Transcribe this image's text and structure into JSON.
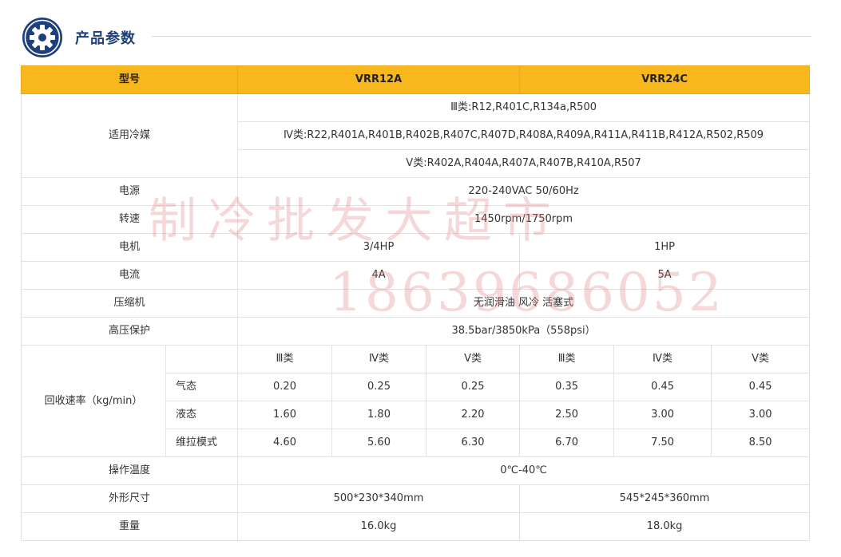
{
  "section": {
    "title": "产品参数",
    "icon": "gear-icon",
    "accent": "#1d3f7c"
  },
  "header": {
    "label": "型号",
    "models": [
      "VRR12A",
      "VRR24C"
    ],
    "color": "#f8b71d"
  },
  "refrigerant": {
    "label": "适用冷媒",
    "lines": [
      "Ⅲ类:R12,R401C,R134a,R500",
      "Ⅳ类:R22,R401A,R401B,R402B,R407C,R407D,R408A,R409A,R411A,R411B,R412A,R502,R509",
      "Ⅴ类:R402A,R404A,R407A,R407B,R410A,R507"
    ]
  },
  "power": {
    "label": "电源",
    "value": "220-240VAC 50/60Hz"
  },
  "speed": {
    "label": "转速",
    "value": "1450rpm/1750rpm"
  },
  "motor": {
    "label": "电机",
    "values": [
      "3/4HP",
      "1HP"
    ]
  },
  "current": {
    "label": "电流",
    "values": [
      "4A",
      "5A"
    ]
  },
  "compressor": {
    "label": "压缩机",
    "value": "无润滑油 风冷 活塞式"
  },
  "hp_protect": {
    "label": "高压保护",
    "value": "38.5bar/3850kPa（558psi）"
  },
  "recovery": {
    "label": "回收速率（kg/min）",
    "classes": [
      "Ⅲ类",
      "Ⅳ类",
      "Ⅴ类",
      "Ⅲ类",
      "Ⅳ类",
      "Ⅴ类"
    ],
    "rows": [
      {
        "name": "气态",
        "values": [
          "0.20",
          "0.25",
          "0.25",
          "0.35",
          "0.45",
          "0.45"
        ]
      },
      {
        "name": "液态",
        "values": [
          "1.60",
          "1.80",
          "2.20",
          "2.50",
          "3.00",
          "3.00"
        ]
      },
      {
        "name": "维拉模式",
        "values": [
          "4.60",
          "5.60",
          "6.30",
          "6.70",
          "7.50",
          "8.50"
        ]
      }
    ]
  },
  "op_temp": {
    "label": "操作温度",
    "value": "0℃-40℃"
  },
  "dimensions": {
    "label": "外形尺寸",
    "values": [
      "500*230*340mm",
      "545*245*360mm"
    ]
  },
  "weight": {
    "label": "重量",
    "values": [
      "16.0kg",
      "18.0kg"
    ]
  },
  "watermark": {
    "text": "制冷批发大超市",
    "phone": "18639686052"
  }
}
